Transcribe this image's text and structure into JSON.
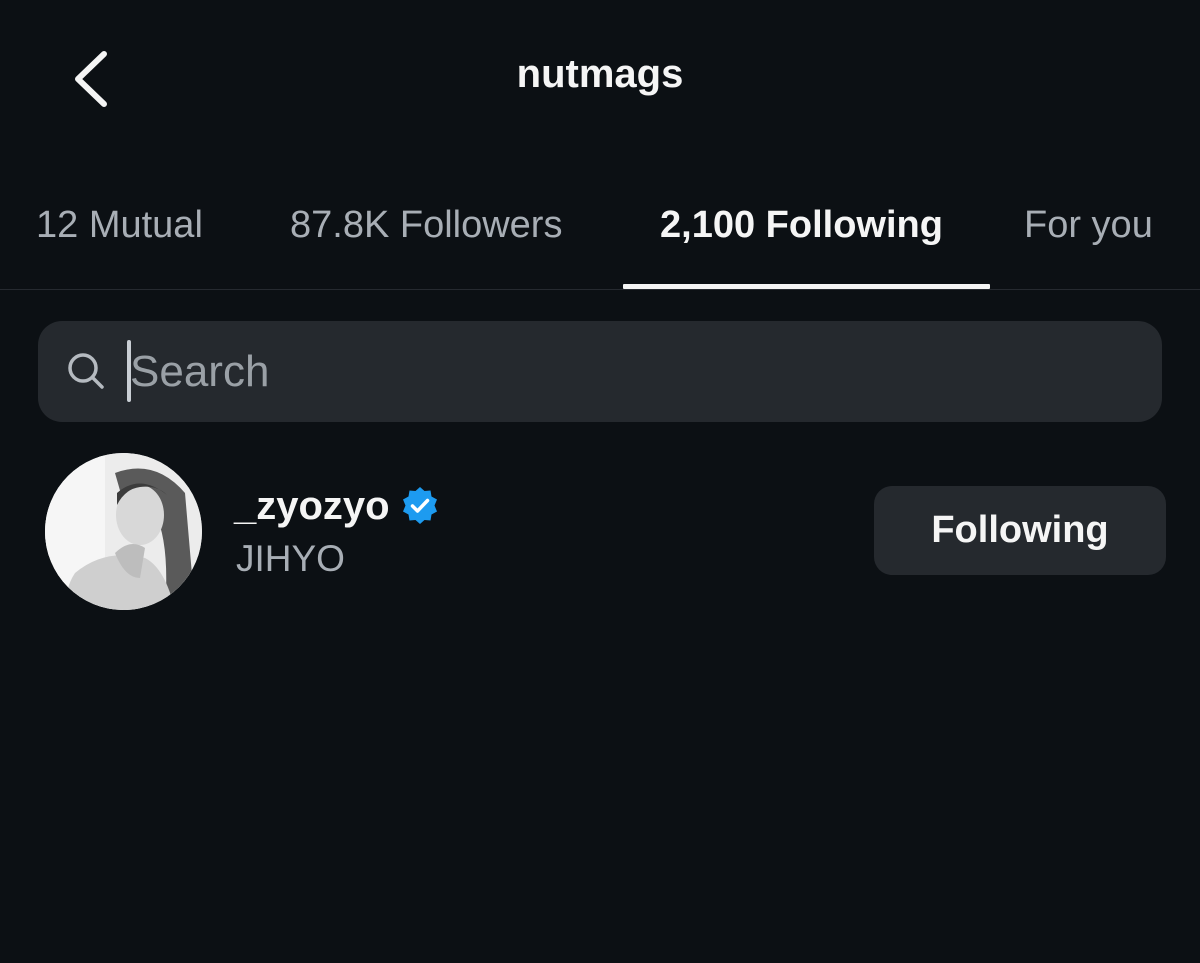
{
  "header": {
    "title": "nutmags",
    "back_icon": "chevron-left-icon"
  },
  "tabs": [
    {
      "label": "12 Mutual",
      "active": false
    },
    {
      "label": "87.8K Followers",
      "active": false
    },
    {
      "label": "2,100 Following",
      "active": true
    },
    {
      "label": "For you",
      "active": false
    }
  ],
  "search": {
    "placeholder": "Search",
    "value": "",
    "icon": "search-icon"
  },
  "list": [
    {
      "username": "_zyozyo",
      "verified": true,
      "full_name": "JIHYO",
      "button_label": "Following",
      "avatar_icon": "profile-photo"
    }
  ],
  "colors": {
    "background": "#0c1014",
    "primary_text": "#f5f5f5",
    "secondary_text": "#a8aeb5",
    "surface": "#25292e",
    "verified_blue": "#1d9bf0"
  }
}
